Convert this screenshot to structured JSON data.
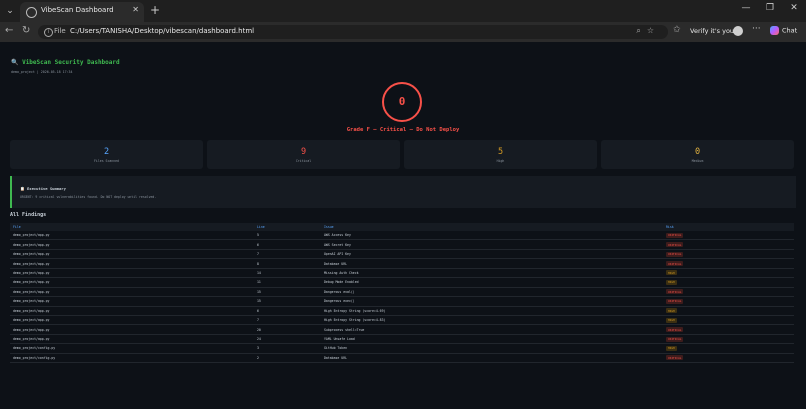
{
  "browser": {
    "tab_title": "VibeScan Dashboard",
    "url_scheme": "File",
    "url_path": "C:/Users/TANISHA/Desktop/vibescan/dashboard.html",
    "profile_label": "Verify it's you",
    "chat_label": "Chat"
  },
  "dashboard": {
    "title": "🔍 VibeScan Security Dashboard",
    "meta": "demo_project | 2026-05-18 17:34",
    "score": "0",
    "grade": "Grade F — Critical — Do Not Deploy",
    "stats": [
      {
        "value": "2",
        "label": "Files Scanned",
        "color": "#58a6ff"
      },
      {
        "value": "9",
        "label": "Critical",
        "color": "#f85149"
      },
      {
        "value": "5",
        "label": "High",
        "color": "#d29922"
      },
      {
        "value": "0",
        "label": "Medium",
        "color": "#e3b341"
      }
    ],
    "summary_title": "📋 Executive Summary",
    "summary_text": "URGENT: 9 critical vulnerabilities found. Do NOT deploy until resolved.",
    "findings_title": "All Findings",
    "columns": [
      "File",
      "Line",
      "Issue",
      "Risk"
    ],
    "rows": [
      {
        "file": "demo_project/app.py",
        "line": "5",
        "issue": "AWS Access Key",
        "risk": "CRITICAL"
      },
      {
        "file": "demo_project/app.py",
        "line": "6",
        "issue": "AWS Secret Key",
        "risk": "CRITICAL"
      },
      {
        "file": "demo_project/app.py",
        "line": "7",
        "issue": "OpenAI API Key",
        "risk": "CRITICAL"
      },
      {
        "file": "demo_project/app.py",
        "line": "8",
        "issue": "Database URL",
        "risk": "CRITICAL"
      },
      {
        "file": "demo_project/app.py",
        "line": "14",
        "issue": "Missing Auth Check",
        "risk": "HIGH"
      },
      {
        "file": "demo_project/app.py",
        "line": "11",
        "issue": "Debug Mode Enabled",
        "risk": "HIGH"
      },
      {
        "file": "demo_project/app.py",
        "line": "15",
        "issue": "Dangerous eval()",
        "risk": "CRITICAL"
      },
      {
        "file": "demo_project/app.py",
        "line": "15",
        "issue": "Dangerous exec()",
        "risk": "CRITICAL"
      },
      {
        "file": "demo_project/app.py",
        "line": "6",
        "issue": "High Entropy String (score=4.69)",
        "risk": "HIGH"
      },
      {
        "file": "demo_project/app.py",
        "line": "7",
        "issue": "High Entropy String (score=4.83)",
        "risk": "HIGH"
      },
      {
        "file": "demo_project/app.py",
        "line": "20",
        "issue": "Subprocess shell=True",
        "risk": "CRITICAL"
      },
      {
        "file": "demo_project/app.py",
        "line": "24",
        "issue": "YAML Unsafe Load",
        "risk": "CRITICAL"
      },
      {
        "file": "demo_project/config.py",
        "line": "3",
        "issue": "GitHub Token",
        "risk": "HIGH"
      },
      {
        "file": "demo_project/config.py",
        "line": "2",
        "issue": "Database URL",
        "risk": "CRITICAL"
      }
    ]
  }
}
